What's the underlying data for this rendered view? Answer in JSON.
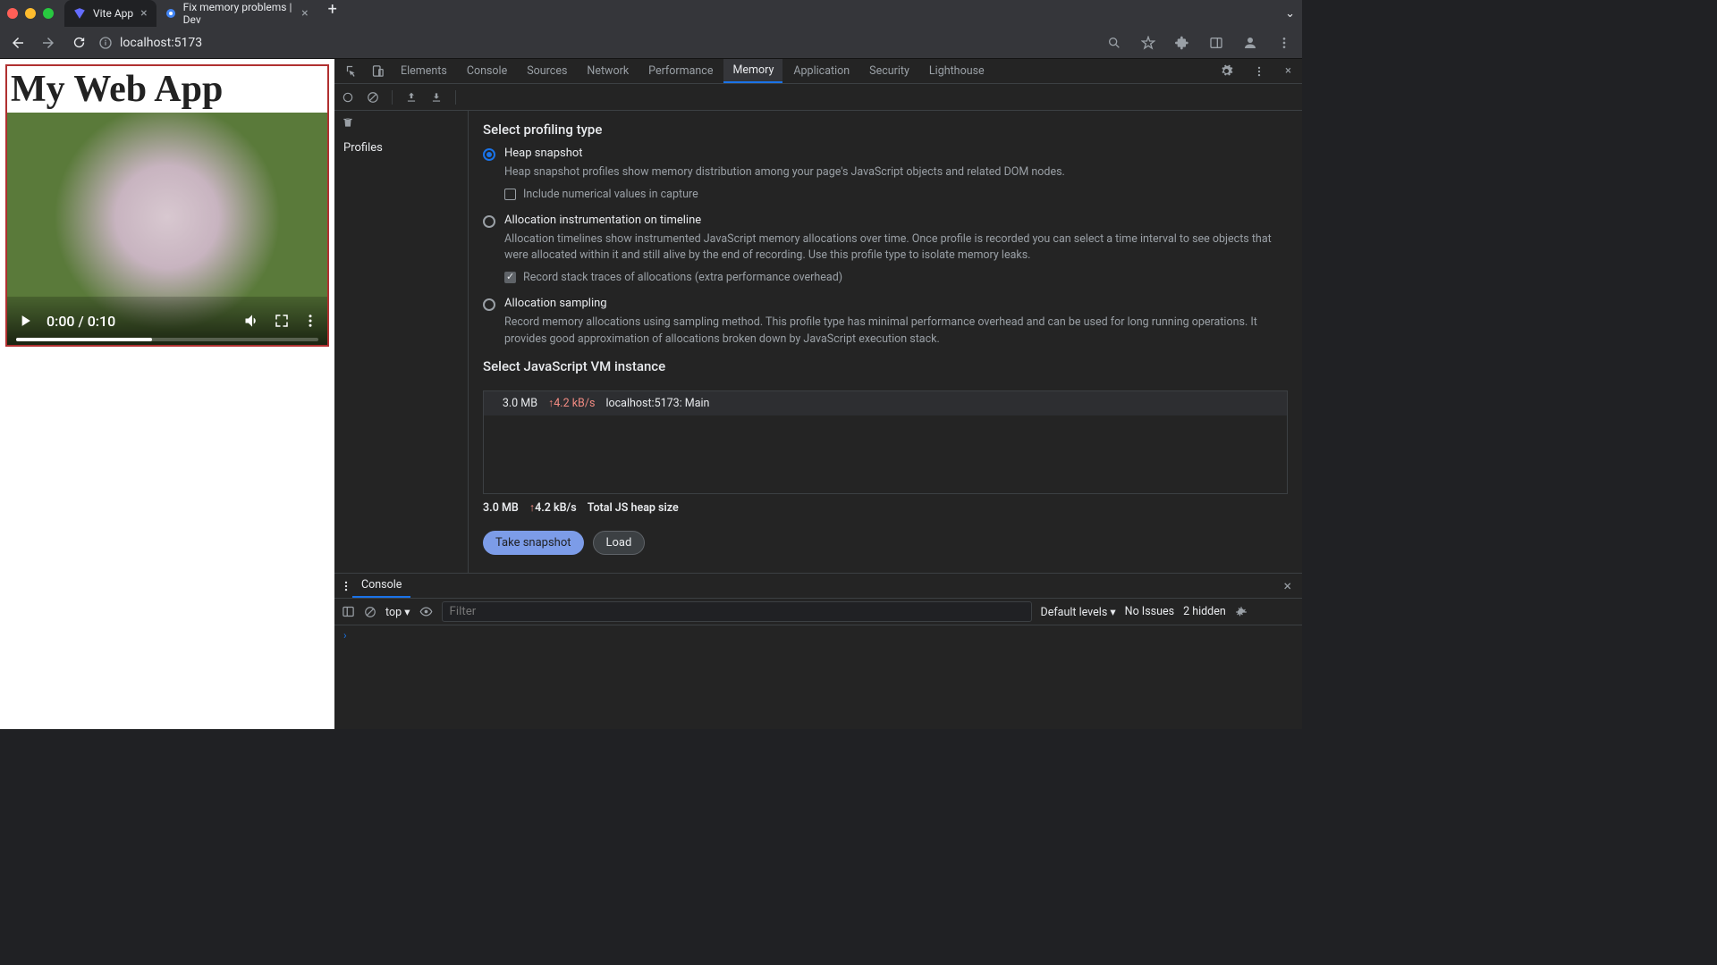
{
  "browser": {
    "tabs": [
      {
        "title": "Vite App",
        "active": true
      },
      {
        "title": "Fix memory problems  |  Dev",
        "active": false
      }
    ],
    "url": "localhost:5173"
  },
  "page": {
    "heading": "My Web App",
    "video": {
      "time": "0:00 / 0:10"
    }
  },
  "devtools": {
    "tabs": [
      "Elements",
      "Console",
      "Sources",
      "Network",
      "Performance",
      "Memory",
      "Application",
      "Security",
      "Lighthouse"
    ],
    "active_tab": "Memory",
    "sidebar": {
      "profiles_label": "Profiles"
    },
    "memory": {
      "section1_title": "Select profiling type",
      "options": {
        "heap": {
          "label": "Heap snapshot",
          "desc": "Heap snapshot profiles show memory distribution among your page's JavaScript objects and related DOM nodes.",
          "checkbox": "Include numerical values in capture"
        },
        "timeline": {
          "label": "Allocation instrumentation on timeline",
          "desc": "Allocation timelines show instrumented JavaScript memory allocations over time. Once profile is recorded you can select a time interval to see objects that were allocated within it and still alive by the end of recording. Use this profile type to isolate memory leaks.",
          "checkbox": "Record stack traces of allocations (extra performance overhead)"
        },
        "sampling": {
          "label": "Allocation sampling",
          "desc": "Record memory allocations using sampling method. This profile type has minimal performance overhead and can be used for long running operations. It provides good approximation of allocations broken down by JavaScript execution stack."
        }
      },
      "section2_title": "Select JavaScript VM instance",
      "vm": {
        "size": "3.0 MB",
        "rate": "4.2 kB/s",
        "name": "localhost:5173: Main"
      },
      "footer": {
        "size": "3.0 MB",
        "rate": "4.2 kB/s",
        "label": "Total JS heap size"
      },
      "take_snapshot": "Take snapshot",
      "load": "Load"
    },
    "console": {
      "tab": "Console",
      "context": "top",
      "filter_placeholder": "Filter",
      "levels": "Default levels",
      "no_issues": "No Issues",
      "hidden": "2 hidden"
    }
  }
}
